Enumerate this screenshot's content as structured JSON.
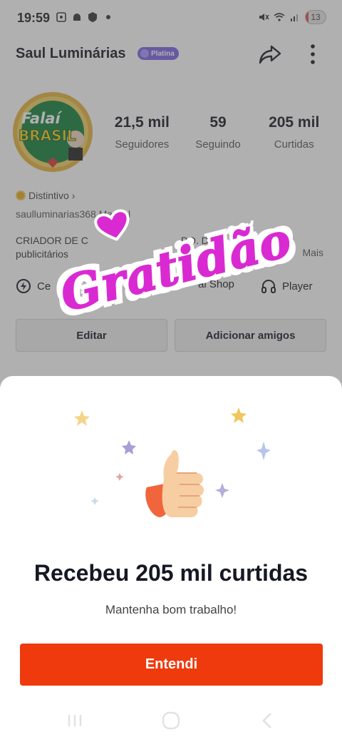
{
  "status_bar": {
    "time": "19:59",
    "battery": "13",
    "battery_fraction": 0.13,
    "icons": [
      "screenshot-icon",
      "android-icon",
      "shield-icon",
      "dot-icon",
      "mute-icon",
      "wifi-icon",
      "signal-icon",
      "battery-icon"
    ]
  },
  "profile": {
    "name": "Saul Luminárias",
    "tier_badge": "Platina",
    "avatar_text": [
      "Falaí",
      "BRASIL"
    ],
    "stats": [
      {
        "value": "21,5 mil",
        "label": "Seguidores"
      },
      {
        "value": "59",
        "label": "Seguindo"
      },
      {
        "value": "205 mil",
        "label": "Curtidas"
      }
    ],
    "badge_label": "Distintivo",
    "username_line": "saulluminarias368   Mascul",
    "bio_line1": "CRIADOR DE C",
    "bio_line1_tail": "DO. D",
    "bio_line2": "publicitários",
    "bio_line2_tail": "S...",
    "bio_more": "Mais",
    "links": [
      {
        "label": "Ce",
        "icon": "bolt-icon"
      },
      {
        "label": "al Shop",
        "icon": "shop-icon"
      },
      {
        "label": "Player",
        "icon": "headphones-icon"
      }
    ],
    "edit_button": "Editar",
    "add_friends_button": "Adicionar amigos"
  },
  "sticker": {
    "text": "Gratidão"
  },
  "sheet": {
    "title": "Recebeu 205 mil curtidas",
    "subtitle": "Mantenha bom trabalho!",
    "confirm_button": "Entendi"
  },
  "colors": {
    "accent": "#ee3a0c",
    "tier_badge": "#7b63e6",
    "sticker": "#d92ad2"
  }
}
